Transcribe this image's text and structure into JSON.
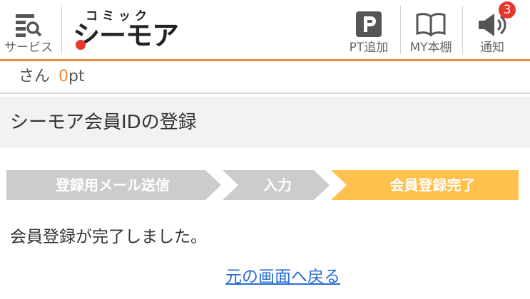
{
  "header": {
    "services_label": "サービス",
    "logo_small": "コミック",
    "logo_main": "シーモア",
    "pt_label": "PT追加",
    "my_shelf_label": "MY本棚",
    "notifications_label": "通知",
    "notifications_count": "3",
    "colors": {
      "accent": "#f08a3c",
      "badge": "#e8382d"
    }
  },
  "points": {
    "prefix": "さん",
    "value": "0",
    "unit": "pt"
  },
  "page_title": "シーモア会員IDの登録",
  "steps": [
    {
      "label": "登録用メール送信",
      "state": "done"
    },
    {
      "label": "入力",
      "state": "done"
    },
    {
      "label": "会員登録完了",
      "state": "current"
    }
  ],
  "step_colors": {
    "inactive": "#cccccc",
    "current": "#ffc04d"
  },
  "message": "会員登録が完了しました。",
  "back_link": "元の画面へ戻る"
}
